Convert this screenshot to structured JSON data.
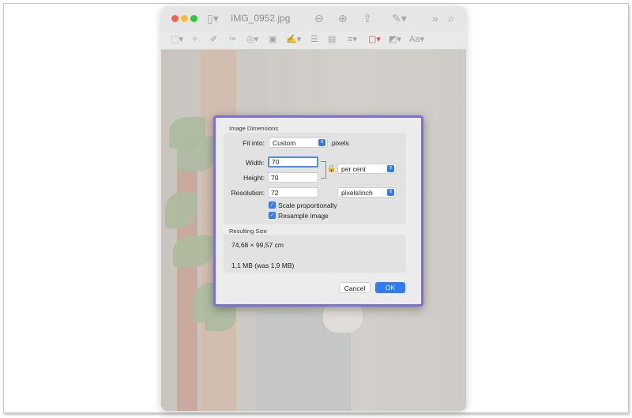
{
  "window": {
    "title": "IMG_0952.jpg",
    "traffic_lights": {
      "close": "#fe5f57",
      "minimize": "#febc2e",
      "zoom": "#28c840"
    },
    "titlebar_icons": [
      "sidebar-icon",
      "zoom-out-icon",
      "zoom-in-icon",
      "share-icon",
      "markup-icon",
      "more-icon",
      "search-icon"
    ],
    "toolbar_tools": [
      "selection-icon",
      "instant-alpha-icon",
      "sketch-icon",
      "shapes-icon",
      "text-icon",
      "sign-icon",
      "adjust-color-icon",
      "adjust-size-icon",
      "border-color-icon",
      "fill-color-icon",
      "text-style-icon"
    ]
  },
  "dialog": {
    "image_dimensions_label": "Image Dimensions",
    "fit_into_label": "Fit into:",
    "fit_into_value": "Custom",
    "fit_into_unit": "pixels",
    "width_label": "Width:",
    "width_value": "70",
    "height_label": "Height:",
    "height_value": "70",
    "size_unit": "per cent",
    "resolution_label": "Resolution:",
    "resolution_value": "72",
    "resolution_unit": "pixels/inch",
    "scale_proportionally_label": "Scale proportionally",
    "scale_proportionally_checked": true,
    "resample_label": "Resample image",
    "resample_checked": true,
    "resulting_size_label": "Resulting Size",
    "resulting_dimensions": "74,68 × 99,57 cm",
    "resulting_file_size": "1,1 MB (was 1,9 MB)",
    "cancel_label": "Cancel",
    "ok_label": "OK",
    "accent": "#3478f6",
    "highlight_border": "#7b6fe0"
  }
}
